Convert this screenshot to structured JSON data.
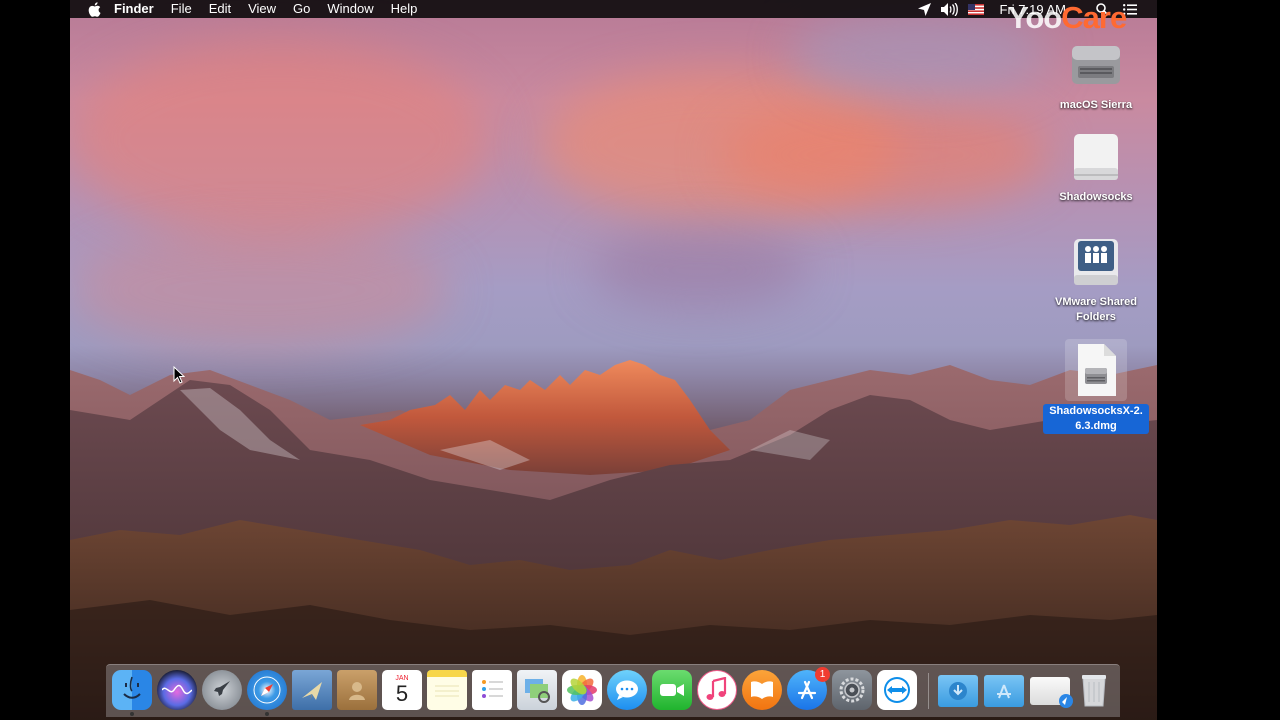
{
  "menubar": {
    "apple_icon": "apple-icon",
    "items": [
      "Finder",
      "File",
      "Edit",
      "View",
      "Go",
      "Window",
      "Help"
    ],
    "status": {
      "location_icon": "location-arrow-icon",
      "volume_icon": "speaker-volume-icon",
      "input_icon": "us-flag-icon",
      "clock": "Fri 7:19 AM",
      "search_icon": "spotlight-search-icon",
      "notifications_icon": "notification-center-icon"
    }
  },
  "watermark": {
    "part1": "Yoo",
    "part2": "Care",
    "accent": "#ff6a32"
  },
  "desktop_icons": [
    {
      "label": "macOS Sierra",
      "icon": "hard-drive-icon"
    },
    {
      "label": "Shadowsocks",
      "icon": "external-drive-icon"
    },
    {
      "label": "VMware Shared Folders",
      "icon": "shared-folders-icon"
    },
    {
      "label": "ShadowsocksX-2.6.3.dmg",
      "icon": "dmg-file-icon",
      "selected": true
    }
  ],
  "dock": {
    "calendar_month": "JAN",
    "calendar_day": "5",
    "appstore_badge": "1",
    "apps": [
      "finder",
      "siri",
      "launchpad",
      "safari",
      "mail",
      "contacts",
      "calendar",
      "notes",
      "reminders",
      "preview",
      "photos",
      "messages",
      "facetime",
      "itunes",
      "ibooks",
      "app-store",
      "system-preferences",
      "teamviewer",
      "downloads-folder",
      "applications-folder",
      "mail-stack",
      "trash"
    ]
  },
  "colors": {
    "selection": "#1766d6",
    "menubar": "#0f0c0e"
  }
}
